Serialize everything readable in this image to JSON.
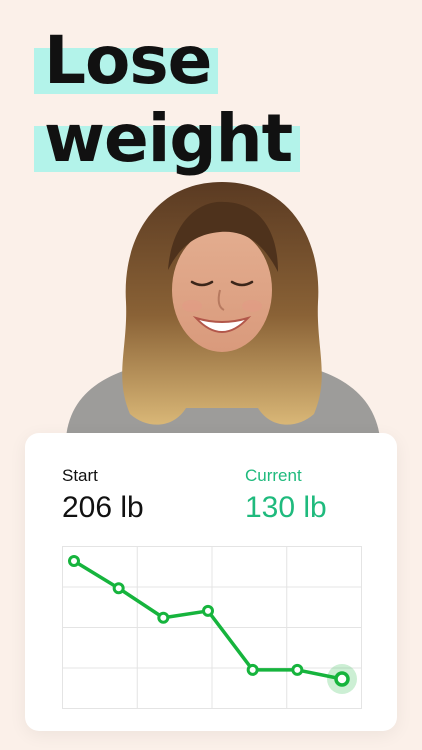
{
  "headline": {
    "line1": "Lose",
    "line2": "weight",
    "highlight_color": "#b3f3ea"
  },
  "card": {
    "start_label": "Start",
    "start_value": "206 lb",
    "current_label": "Current",
    "current_value": "130 lb",
    "accent_color": "#1fba7d"
  },
  "chart_data": {
    "type": "line",
    "x": [
      1,
      2,
      3,
      4,
      5,
      6,
      7
    ],
    "series": [
      {
        "values": [
          206,
          194,
          181,
          184,
          158,
          158,
          154
        ],
        "color": "#16b43d"
      }
    ],
    "grid": true,
    "highlight_last_point": true,
    "title": "",
    "xlabel": "",
    "ylabel": ""
  },
  "icons": {
    "person_photo": "smiling-woman-photo"
  }
}
